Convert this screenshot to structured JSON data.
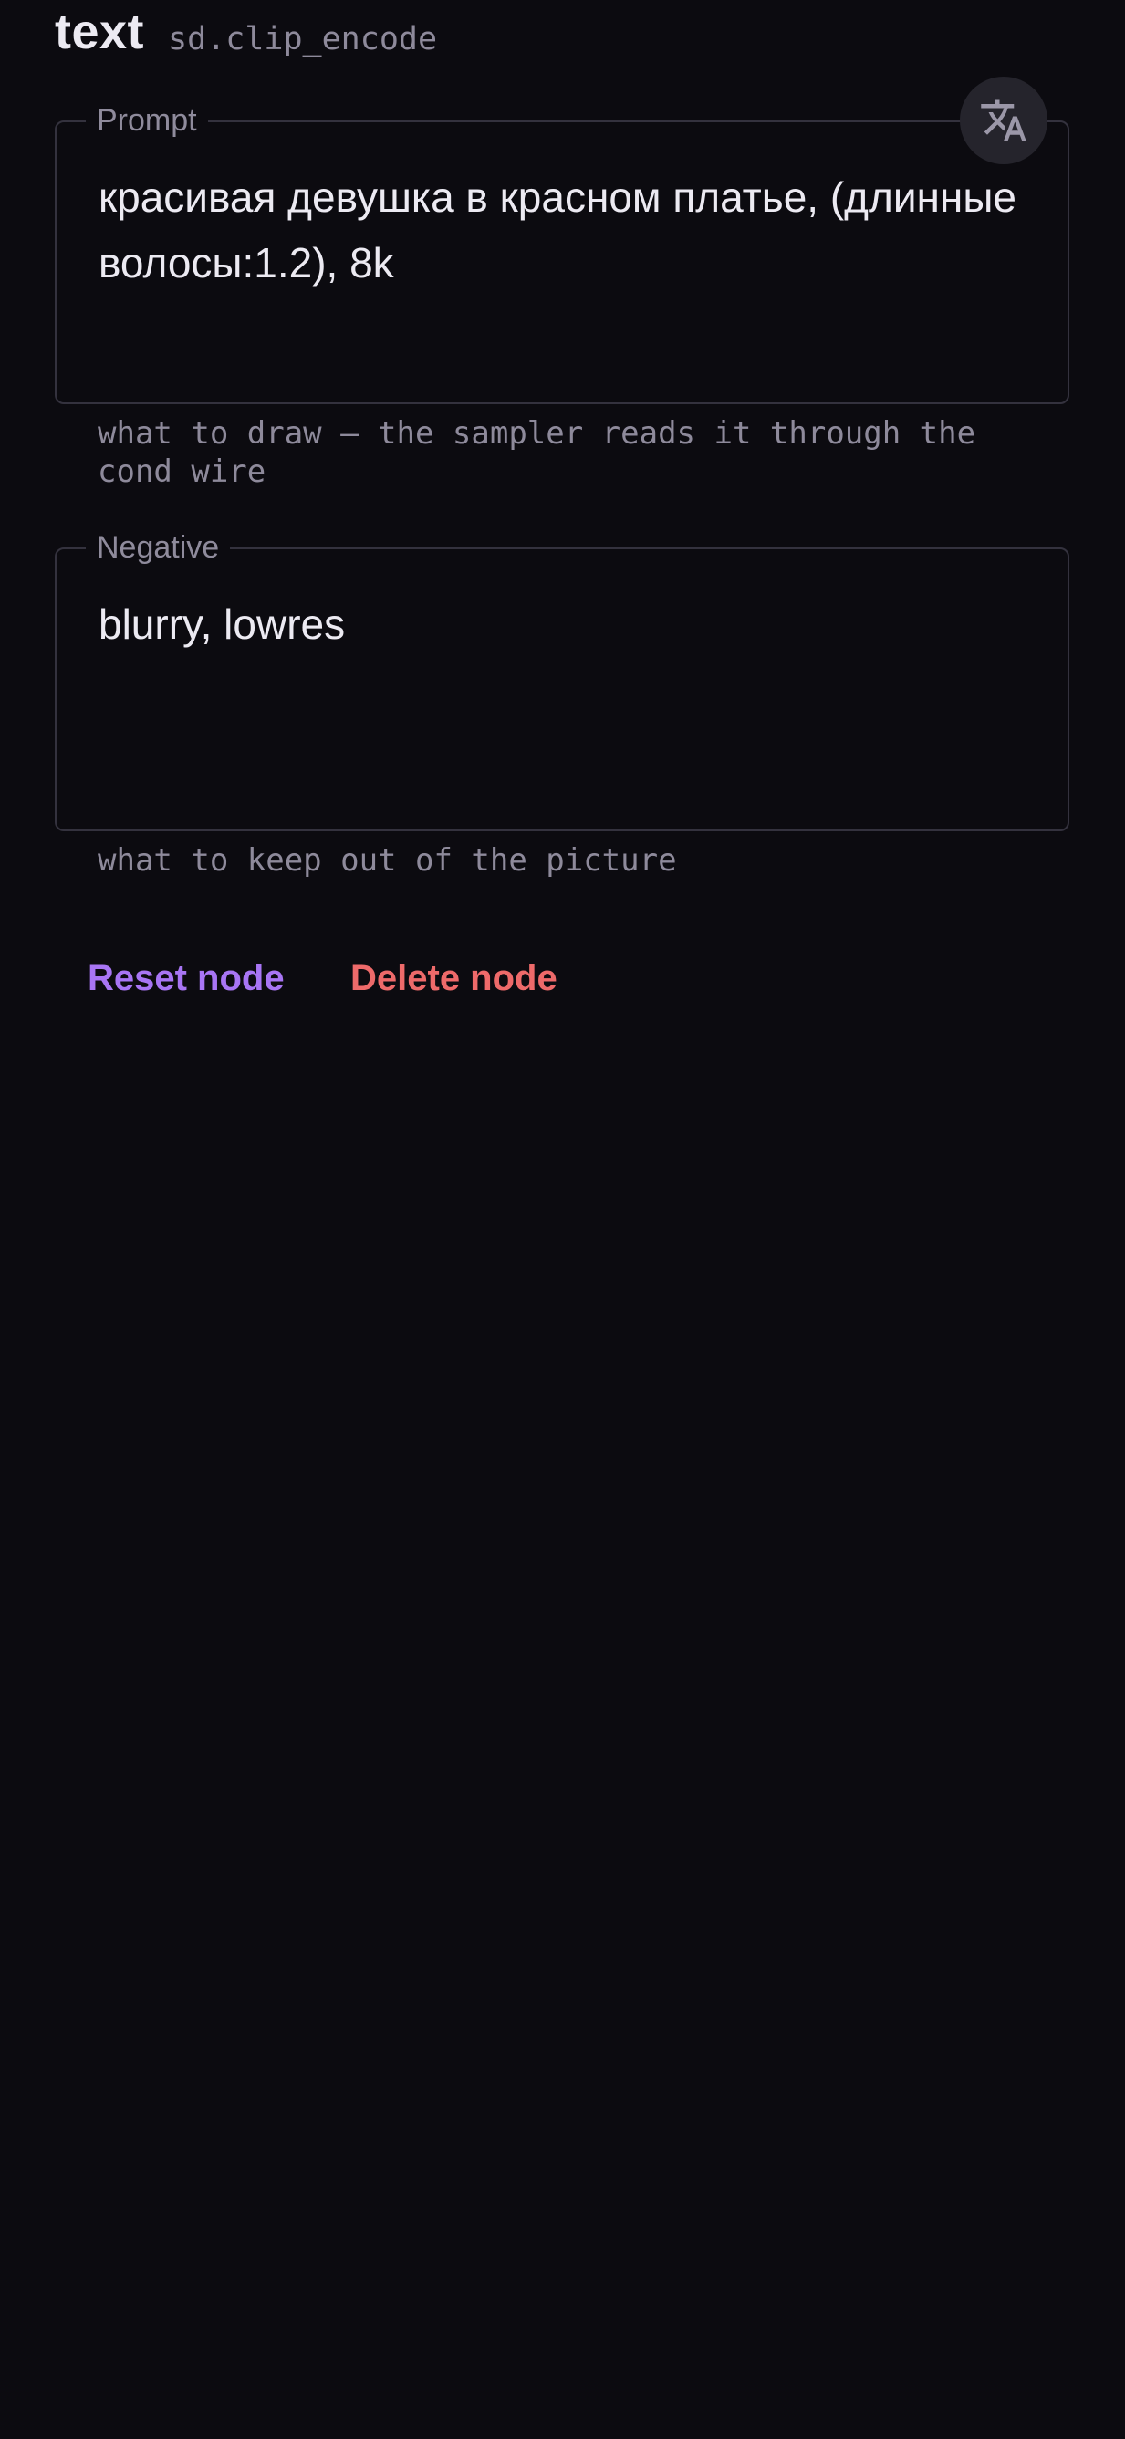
{
  "node": {
    "title": "text",
    "type": "sd.clip_encode"
  },
  "translate_button": {
    "icon": "translate-icon"
  },
  "fields": {
    "prompt": {
      "label": "Prompt",
      "value": "красивая девушка в красном платье, (длинные волосы:1.2), 8k",
      "helper": "what to draw — the sampler reads it through the cond wire"
    },
    "negative": {
      "label": "Negative",
      "value": "blurry, lowres",
      "helper": "what to keep out of the picture"
    }
  },
  "actions": {
    "reset_label": "Reset node",
    "delete_label": "Delete node"
  },
  "colors": {
    "background": "#0c0b10",
    "reset": "#a875f4",
    "delete": "#ee6a6a",
    "border": "#34323e",
    "muted_text": "#8e8a9b"
  }
}
